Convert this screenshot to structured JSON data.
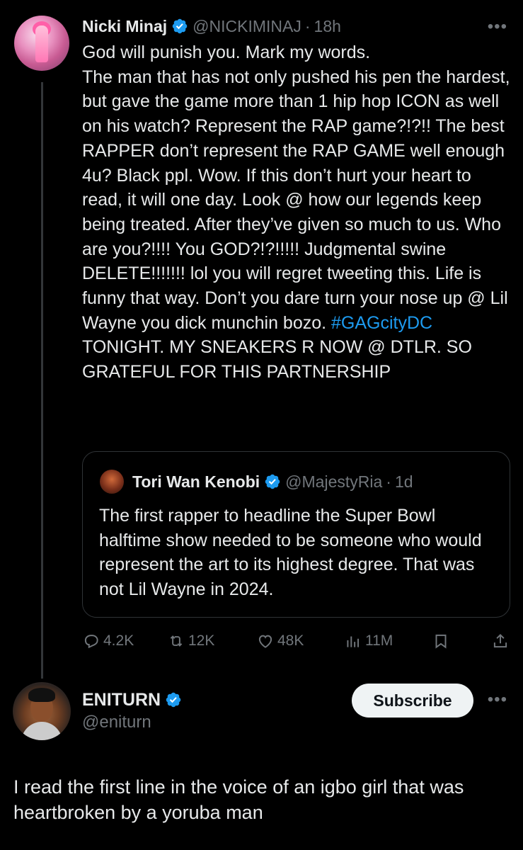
{
  "tweet": {
    "name": "Nicki Minaj",
    "handle": "@NICKIMINAJ",
    "separator": "·",
    "time": "18h",
    "more": "•••",
    "body_text": "God will punish you. Mark my words.\nThe man that has not only pushed his pen the hardest, but gave the game more than 1 hip hop ICON as well on his watch? Represent the RAP game?!?!! The best RAPPER don’t represent the RAP GAME well enough 4u? Black ppl. Wow. If this don’t hurt your heart to read, it will one day. Look @ how our legends keep being treated. After they’ve given so much to us. Who are you?!!!! You GOD?!?!!!!! Judgmental swine DELETE!!!!!!! lol you will regret tweeting this. Life is funny that way. Don’t you dare turn your nose up @ Lil Wayne you dick munchin bozo. ",
    "hashtag": "#GAGcityDC",
    "body_text_after": " TONIGHT. MY SNEAKERS R NOW @ DTLR. SO GRATEFUL FOR THIS PARTNERSHIP",
    "quote": {
      "name": "Tori Wan Kenobi",
      "handle": "@MajestyRia",
      "separator": "·",
      "time": "1d",
      "text": "The first rapper to headline the Super Bowl halftime show needed to be someone who would represent the art to its highest degree. That was not Lil Wayne in 2024."
    },
    "actions": {
      "replies": "4.2K",
      "reposts": "12K",
      "likes": "48K",
      "views": "11M"
    }
  },
  "reply": {
    "name": "ENITURN",
    "handle": "@eniturn",
    "subscribe_label": "Subscribe",
    "more": "•••",
    "text": "I read the first line in the voice of an igbo girl that was heartbroken by a yoruba man"
  },
  "colors": {
    "background": "#000000",
    "text": "#e7e9ea",
    "secondary": "#71767b",
    "link": "#1d9bf0",
    "verified": "#1d9bf0"
  },
  "icons": [
    "verified-badge-icon",
    "reply-icon",
    "repost-icon",
    "like-icon",
    "views-icon",
    "bookmark-icon",
    "share-icon",
    "more-icon"
  ]
}
